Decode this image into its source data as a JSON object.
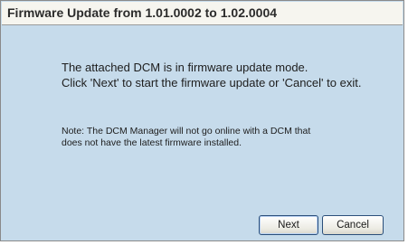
{
  "dialog": {
    "title": "Firmware Update from 1.01.0002 to 1.02.0004",
    "message_line1": "The attached DCM is in firmware update mode.",
    "message_line2": "Click 'Next' to start the firmware update or 'Cancel' to exit.",
    "note_line1": "Note: The DCM Manager will not go online with a DCM that",
    "note_line2": "does not have the latest firmware installed.",
    "next_label": "Next",
    "cancel_label": "Cancel"
  },
  "colors": {
    "background": "#c6dbeb",
    "titlebar": "#f6f5ef",
    "button_border": "#2b4f7a"
  }
}
